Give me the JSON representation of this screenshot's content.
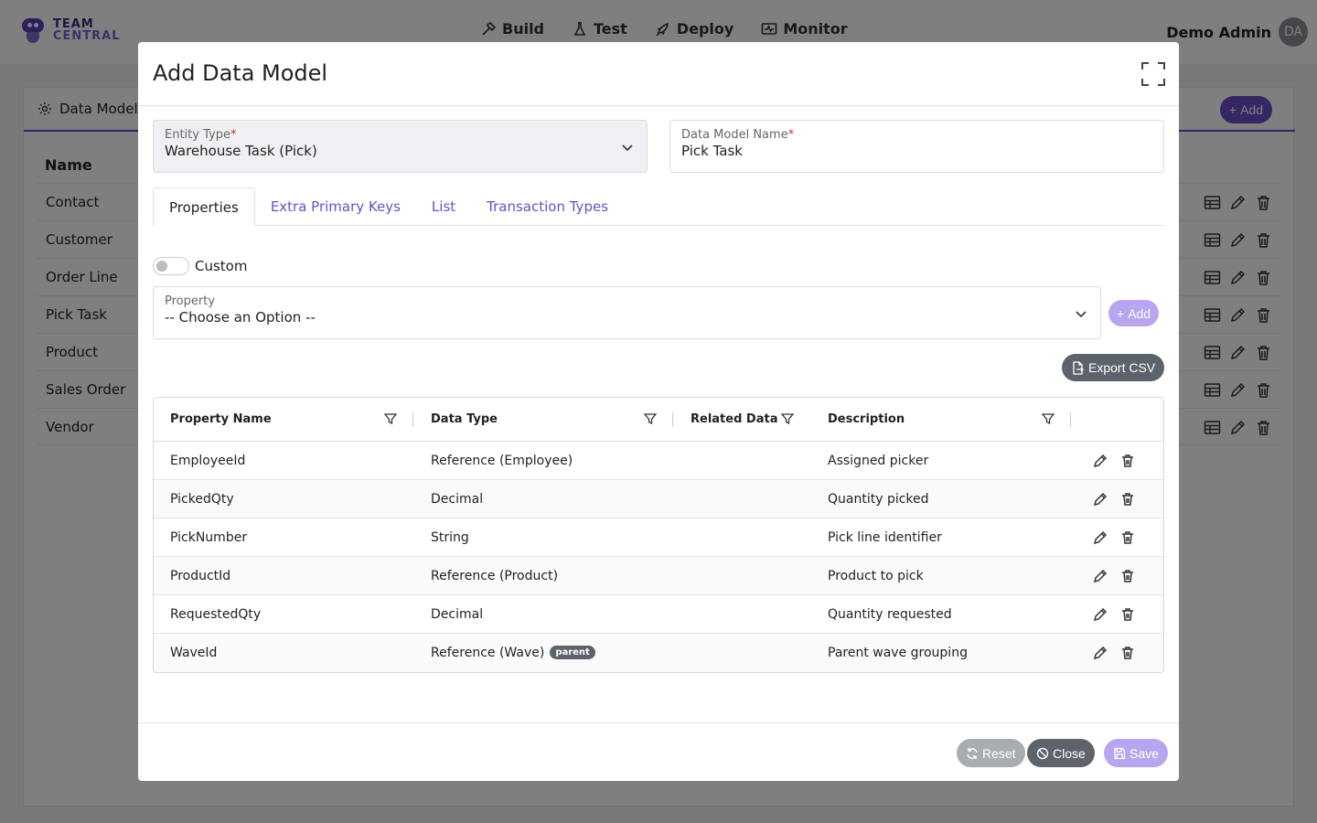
{
  "app": {
    "logo_line1": "TEAM",
    "logo_line2": "CENTRAL",
    "nav": [
      {
        "label": "Build",
        "icon": "hammer-icon"
      },
      {
        "label": "Test",
        "icon": "flask-icon"
      },
      {
        "label": "Deploy",
        "icon": "rocket-icon"
      },
      {
        "label": "Monitor",
        "icon": "monitor-icon"
      }
    ],
    "user_name": "Demo Admin",
    "user_initials": "DA"
  },
  "background": {
    "tab_label": "Data Models",
    "add_label": "Add",
    "column_name": "Name",
    "rows": [
      "Contact",
      "Customer",
      "Order Line",
      "Pick Task",
      "Product",
      "Sales Order",
      "Vendor"
    ]
  },
  "modal": {
    "title": "Add Data Model",
    "entity_type": {
      "label": "Entity Type",
      "value": "Warehouse Task (Pick)"
    },
    "data_model_name": {
      "label": "Data Model Name",
      "value": "Pick Task"
    },
    "tabs": [
      {
        "label": "Properties",
        "active": true
      },
      {
        "label": "Extra Primary Keys",
        "active": false
      },
      {
        "label": "List",
        "active": false
      },
      {
        "label": "Transaction Types",
        "active": false
      }
    ],
    "custom_toggle": {
      "label": "Custom",
      "checked": false
    },
    "property": {
      "label": "Property",
      "value": "-- Choose an Option --"
    },
    "add_label": "Add",
    "export_label": "Export CSV",
    "grid": {
      "columns": [
        "Property Name",
        "Data Type",
        "Related Data",
        "Description"
      ],
      "rows": [
        {
          "name": "EmployeeId",
          "type": "Reference (Employee)",
          "badge": "",
          "related": "",
          "description": "Assigned picker"
        },
        {
          "name": "PickedQty",
          "type": "Decimal",
          "badge": "",
          "related": "",
          "description": "Quantity picked"
        },
        {
          "name": "PickNumber",
          "type": "String",
          "badge": "",
          "related": "",
          "description": "Pick line identifier"
        },
        {
          "name": "ProductId",
          "type": "Reference (Product)",
          "badge": "",
          "related": "",
          "description": "Product to pick"
        },
        {
          "name": "RequestedQty",
          "type": "Decimal",
          "badge": "",
          "related": "",
          "description": "Quantity requested"
        },
        {
          "name": "WaveId",
          "type": "Reference (Wave)",
          "badge": "parent",
          "related": "",
          "description": "Parent wave grouping"
        }
      ]
    },
    "footer": {
      "reset_label": "Reset",
      "close_label": "Close",
      "save_label": "Save"
    }
  },
  "colors": {
    "accent": "#6a4fc9",
    "accent_light": "#b9a5ef",
    "secondary": "#5c636a",
    "required": "#d32f2f"
  }
}
